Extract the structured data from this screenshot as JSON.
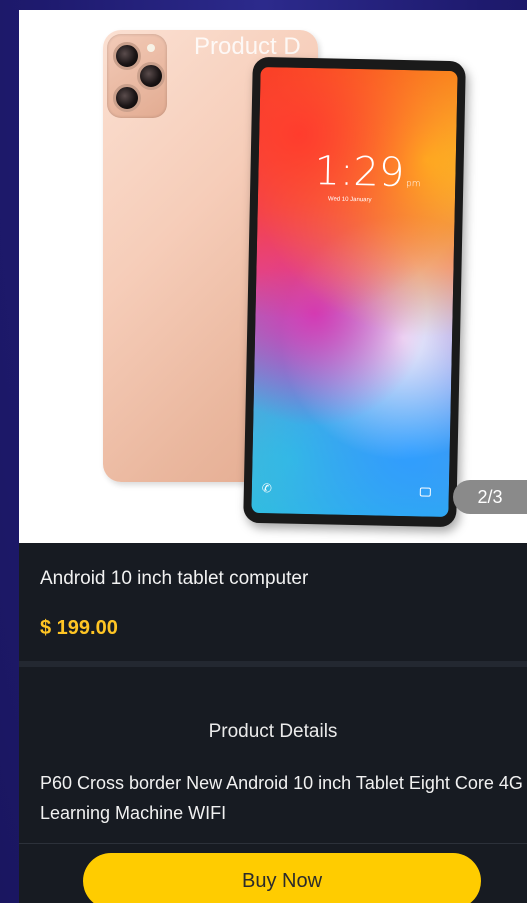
{
  "header": {
    "title": "Product D"
  },
  "gallery": {
    "counter": "2/3",
    "tablet_screen": {
      "clock": "1:29",
      "clock_suffix": "pm",
      "date": "Wed 10 January"
    }
  },
  "product": {
    "name": "Android 10 inch tablet computer",
    "price": "$ 199.00"
  },
  "details": {
    "heading": "Product Details",
    "description": "P60 Cross border New Android 10 inch Tablet Eight Core 4G Learning Machine WIFI"
  },
  "actions": {
    "buy_label": "Buy Now"
  },
  "colors": {
    "page_background": "#1f1a73",
    "panel_background": "#171b22",
    "price": "#ffc524",
    "buy_button": "#ffcc00",
    "counter_badge": "#8a8a8a"
  },
  "icons": [
    "phone-icon",
    "camera-icon"
  ]
}
